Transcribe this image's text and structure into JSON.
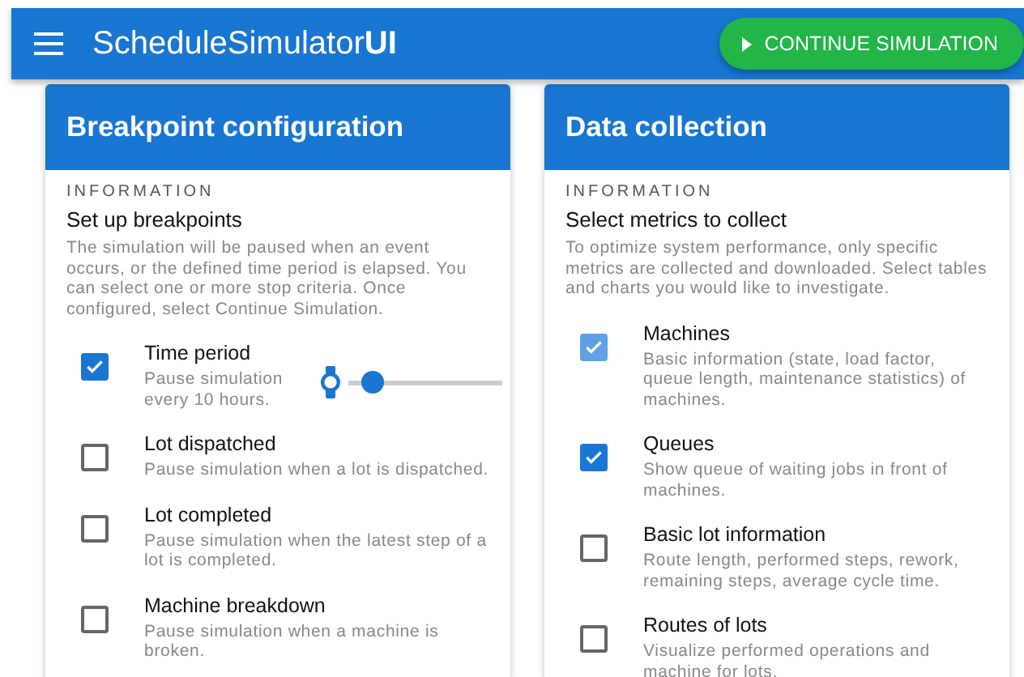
{
  "app_bar": {
    "title_regular": "ScheduleSimulator",
    "title_bold": "UI",
    "action_button": "CONTINUE SIMULATION"
  },
  "cards": [
    {
      "title": "Breakpoint configuration",
      "overline": "INFORMATION",
      "subtitle": "Set up breakpoints",
      "description": "The simulation will be paused when an event occurs, or the defined time period is elapsed. You can select one or more stop criteria. Once configured, select Continue Simulation.",
      "options": [
        {
          "kind": "slider",
          "label": "Time period",
          "description": "Pause simulation every 10 hours.",
          "checked": true,
          "disabled": false,
          "level": 0.08
        },
        {
          "kind": "plain",
          "label": "Lot dispatched",
          "description": "Pause simulation when a lot is dispatched.",
          "checked": false,
          "disabled": false
        },
        {
          "kind": "plain",
          "label": "Lot completed",
          "description": "Pause simulation when the latest step of a lot is completed.",
          "checked": false,
          "disabled": false
        },
        {
          "kind": "plain",
          "label": "Machine breakdown",
          "description": "Pause simulation when a machine is broken.",
          "checked": false,
          "disabled": false
        }
      ]
    },
    {
      "title": "Data collection",
      "overline": "INFORMATION",
      "subtitle": "Select metrics to collect",
      "description": "To optimize system performance, only specific metrics are collected and downloaded. Select tables and charts you would like to investigate.",
      "options": [
        {
          "kind": "plain",
          "label": "Machines",
          "description": "Basic information (state, load factor, queue length, maintenance statistics) of machines.",
          "checked": true,
          "disabled": true
        },
        {
          "kind": "plain",
          "label": "Queues",
          "description": "Show queue of waiting jobs in front of machines.",
          "checked": true,
          "disabled": false
        },
        {
          "kind": "plain",
          "label": "Basic lot information",
          "description": "Route length, performed steps, rework, remaining steps, average cycle time.",
          "checked": false,
          "disabled": false
        },
        {
          "kind": "plain",
          "label": "Routes of lots",
          "description": "Visualize performed operations and machine for lots.",
          "checked": false,
          "disabled": false
        }
      ]
    }
  ]
}
